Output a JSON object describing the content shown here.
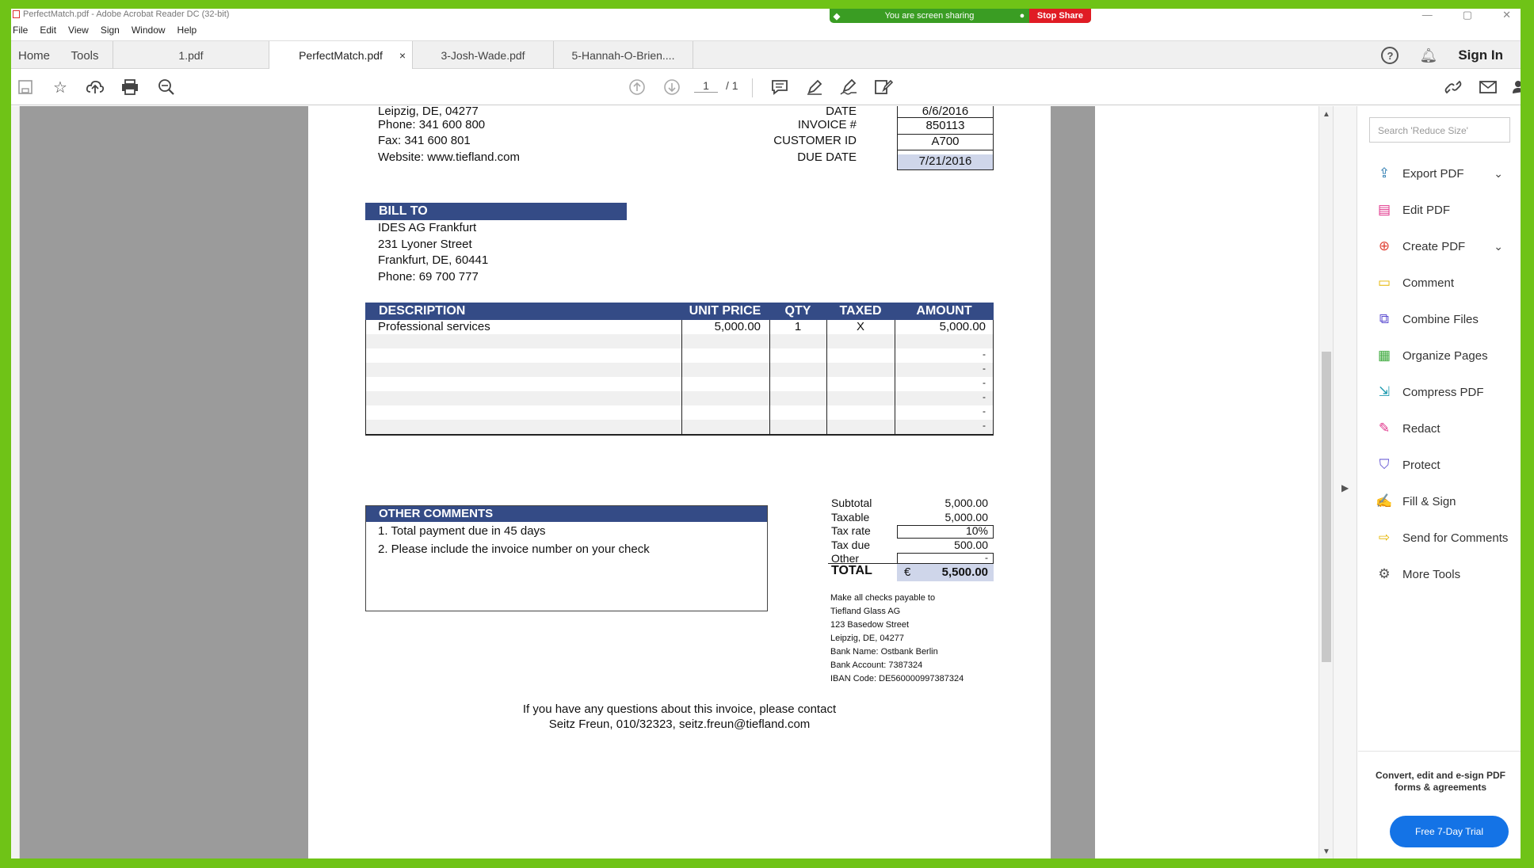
{
  "window": {
    "title": "PerfectMatch.pdf - Adobe Acrobat Reader DC (32-bit)",
    "controls": [
      "—",
      "▢",
      "✕"
    ]
  },
  "screen_share": {
    "message": "You are screen sharing",
    "stop_label": "Stop Share"
  },
  "menu": [
    "File",
    "Edit",
    "View",
    "Sign",
    "Window",
    "Help"
  ],
  "tabs": {
    "home": "Home",
    "tools": "Tools",
    "docs": [
      "1.pdf",
      "PerfectMatch.pdf",
      "3-Josh-Wade.pdf",
      "5-Hannah-O-Brien...."
    ],
    "close": "×",
    "help": "?",
    "signin": "Sign In"
  },
  "toolbar": {
    "page_current": "1",
    "page_total": "/ 1"
  },
  "right_pane": {
    "search_placeholder": "Search 'Reduce Size'",
    "tools": [
      {
        "label": "Export PDF",
        "icon": "export-pdf-icon",
        "color": "#2a7ab0",
        "chevron": true
      },
      {
        "label": "Edit PDF",
        "icon": "edit-pdf-icon",
        "color": "#e0338a",
        "chevron": false
      },
      {
        "label": "Create PDF",
        "icon": "create-pdf-icon",
        "color": "#e0453a",
        "chevron": true
      },
      {
        "label": "Comment",
        "icon": "comment-icon",
        "color": "#e5b500",
        "chevron": false
      },
      {
        "label": "Combine Files",
        "icon": "combine-files-icon",
        "color": "#5b4cd0",
        "chevron": false
      },
      {
        "label": "Organize Pages",
        "icon": "organize-pages-icon",
        "color": "#3aa83a",
        "chevron": false
      },
      {
        "label": "Compress PDF",
        "icon": "compress-pdf-icon",
        "color": "#1f9bb0",
        "chevron": false
      },
      {
        "label": "Redact",
        "icon": "redact-icon",
        "color": "#e0338a",
        "chevron": false
      },
      {
        "label": "Protect",
        "icon": "protect-icon",
        "color": "#5b4cd0",
        "chevron": false
      },
      {
        "label": "Fill & Sign",
        "icon": "fill-sign-icon",
        "color": "#8b3ad0",
        "chevron": false
      },
      {
        "label": "Send for Comments",
        "icon": "send-comments-icon",
        "color": "#e5b500",
        "chevron": false
      },
      {
        "label": "More Tools",
        "icon": "more-tools-icon",
        "color": "#555555",
        "chevron": false
      }
    ],
    "promo": "Convert, edit and e-sign PDF forms & agreements",
    "trial_button": "Free 7-Day Trial"
  },
  "invoice": {
    "seller": {
      "city_line": "Leipzig, DE, 04277",
      "phone": "Phone: 341 600 800",
      "fax": "Fax: 341 600 801",
      "website": "Website: www.tiefland.com"
    },
    "meta": [
      {
        "label": "DATE",
        "value": "6/6/2016"
      },
      {
        "label": "INVOICE #",
        "value": "850113"
      },
      {
        "label": "CUSTOMER ID",
        "value": "A700"
      },
      {
        "label": "DUE DATE",
        "value": "7/21/2016"
      }
    ],
    "bill_to": {
      "heading": "BILL TO",
      "lines": [
        "IDES AG Frankfurt",
        "231 Lyoner Street",
        "Frankfurt, DE, 60441",
        "Phone: 69 700 777"
      ]
    },
    "table": {
      "headers": [
        "DESCRIPTION",
        "UNIT PRICE",
        "QTY",
        "TAXED",
        "AMOUNT"
      ],
      "rows": [
        [
          "Professional services",
          "5,000.00",
          "1",
          "X",
          "5,000.00"
        ],
        [
          "",
          "",
          "",
          "",
          ""
        ],
        [
          "",
          "",
          "",
          "",
          "-"
        ],
        [
          "",
          "",
          "",
          "",
          "-"
        ],
        [
          "",
          "",
          "",
          "",
          "-"
        ],
        [
          "",
          "",
          "",
          "",
          "-"
        ],
        [
          "",
          "",
          "",
          "",
          "-"
        ],
        [
          "",
          "",
          "",
          "",
          "-"
        ]
      ]
    },
    "totals": [
      {
        "label": "Subtotal",
        "value": "5,000.00"
      },
      {
        "label": "Taxable",
        "value": "5,000.00"
      },
      {
        "label": "Tax rate",
        "value": "10%"
      },
      {
        "label": "Tax due",
        "value": "500.00"
      },
      {
        "label": "Other",
        "value": "-"
      }
    ],
    "total": {
      "label": "TOTAL",
      "currency": "€",
      "value": "5,500.00"
    },
    "comments": {
      "heading": "OTHER COMMENTS",
      "lines": [
        "1. Total payment due in 45 days",
        "2. Please include the invoice number on your check"
      ]
    },
    "payable": [
      "Make all checks payable to",
      "Tiefland Glass AG",
      "123 Basedow Street",
      "Leipzig, DE, 04277",
      "Bank Name: Ostbank Berlin",
      "Bank Account: 7387324",
      "IBAN Code: DE560000997387324"
    ],
    "footer": [
      "If you have any questions about this invoice, please contact",
      "Seitz Freun, 010/32323, seitz.freun@tiefland.com"
    ]
  }
}
